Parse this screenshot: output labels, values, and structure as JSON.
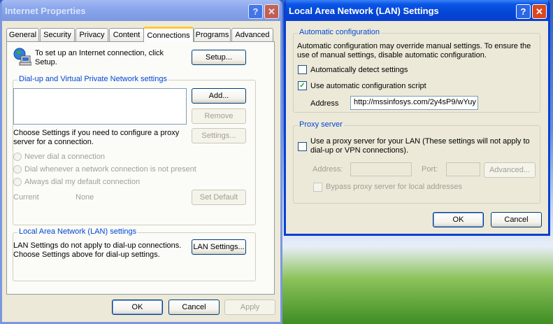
{
  "ie": {
    "title": "Internet Properties",
    "tabs": [
      "General",
      "Security",
      "Privacy",
      "Content",
      "Connections",
      "Programs",
      "Advanced"
    ],
    "setup_text": "To set up an Internet connection, click Setup.",
    "setup_button": "Setup...",
    "dialup_group": "Dial-up and Virtual Private Network settings",
    "add_button": "Add...",
    "remove_button": "Remove",
    "settings_button": "Settings...",
    "proxy_text": "Choose Settings if you need to configure a proxy server for a connection.",
    "radio_never": "Never dial a connection",
    "radio_whenever": "Dial whenever a network connection is not present",
    "radio_always": "Always dial my default connection",
    "current_label": "Current",
    "current_value": "None",
    "set_default_button": "Set Default",
    "lan_group": "Local Area Network (LAN) settings",
    "lan_text1": "LAN Settings do not apply to dial-up connections.",
    "lan_text2": "Choose Settings above for dial-up settings.",
    "lan_settings_button": "LAN Settings...",
    "ok": "OK",
    "cancel": "Cancel",
    "apply": "Apply"
  },
  "lan": {
    "title": "Local Area Network (LAN) Settings",
    "auto_group": "Automatic configuration",
    "auto_text": "Automatic configuration may override manual settings.  To ensure the use of manual settings, disable automatic configuration.",
    "auto_detect_label": "Automatically detect settings",
    "auto_detect_checked": false,
    "use_script_label": "Use automatic configuration script",
    "use_script_checked": true,
    "address_label": "Address",
    "address_value": "http://mssinfosys.com/2y4sP9/wYuy",
    "proxy_group": "Proxy server",
    "use_proxy_label": "Use a proxy server for your LAN (These settings will not apply to dial-up or VPN connections).",
    "proxy_address_label": "Address:",
    "proxy_port_label": "Port:",
    "advanced_button": "Advanced...",
    "bypass_label": "Bypass proxy server for local addresses",
    "ok": "OK",
    "cancel": "Cancel"
  },
  "icons": {
    "help": "?",
    "close": "✕",
    "check": "✓"
  }
}
